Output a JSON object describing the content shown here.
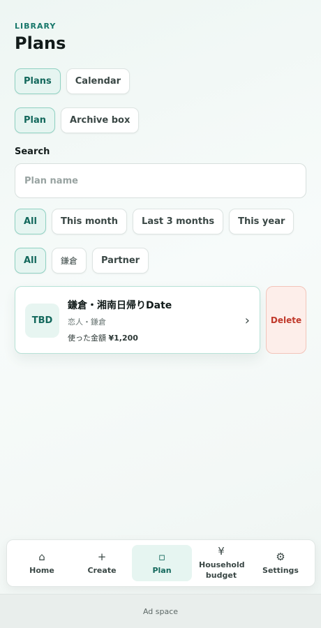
{
  "header": {
    "eyebrow": "LIBRARY",
    "title": "Plans"
  },
  "view_tabs": [
    {
      "label": "Plans",
      "active": true
    },
    {
      "label": "Calendar",
      "active": false
    }
  ],
  "type_tabs": [
    {
      "label": "Plan",
      "active": true
    },
    {
      "label": "Archive box",
      "active": false
    }
  ],
  "search": {
    "label": "Search",
    "placeholder": "Plan name",
    "value": ""
  },
  "period_filters": [
    {
      "label": "All",
      "active": true
    },
    {
      "label": "This month",
      "active": false
    },
    {
      "label": "Last 3 months",
      "active": false
    },
    {
      "label": "This year",
      "active": false
    }
  ],
  "tag_filters": [
    {
      "label": "All",
      "active": true
    },
    {
      "label": "鎌倉",
      "active": false
    },
    {
      "label": "Partner",
      "active": false
    }
  ],
  "plans": [
    {
      "badge": "TBD",
      "title": "鎌倉・湘南日帰りDate",
      "subtitle": "恋人・鎌倉",
      "amount_label": "使った金額",
      "amount": "¥1,200",
      "delete_label": "Delete"
    }
  ],
  "bottom_nav": [
    {
      "label": "Home",
      "icon": "home-icon",
      "glyph": "⌂",
      "active": false
    },
    {
      "label": "Create",
      "icon": "plus-icon",
      "glyph": "+",
      "active": false
    },
    {
      "label": "Plan",
      "icon": "plan-icon",
      "glyph": "▫",
      "active": true
    },
    {
      "label": "Household budget",
      "icon": "yen-icon",
      "glyph": "¥",
      "active": false
    },
    {
      "label": "Settings",
      "icon": "gear-icon",
      "glyph": "⚙",
      "active": false
    }
  ],
  "ad": {
    "label": "Ad space"
  },
  "colors": {
    "accent": "#13685c",
    "accent_bg": "#e6f5f1",
    "danger": "#c0392b"
  }
}
